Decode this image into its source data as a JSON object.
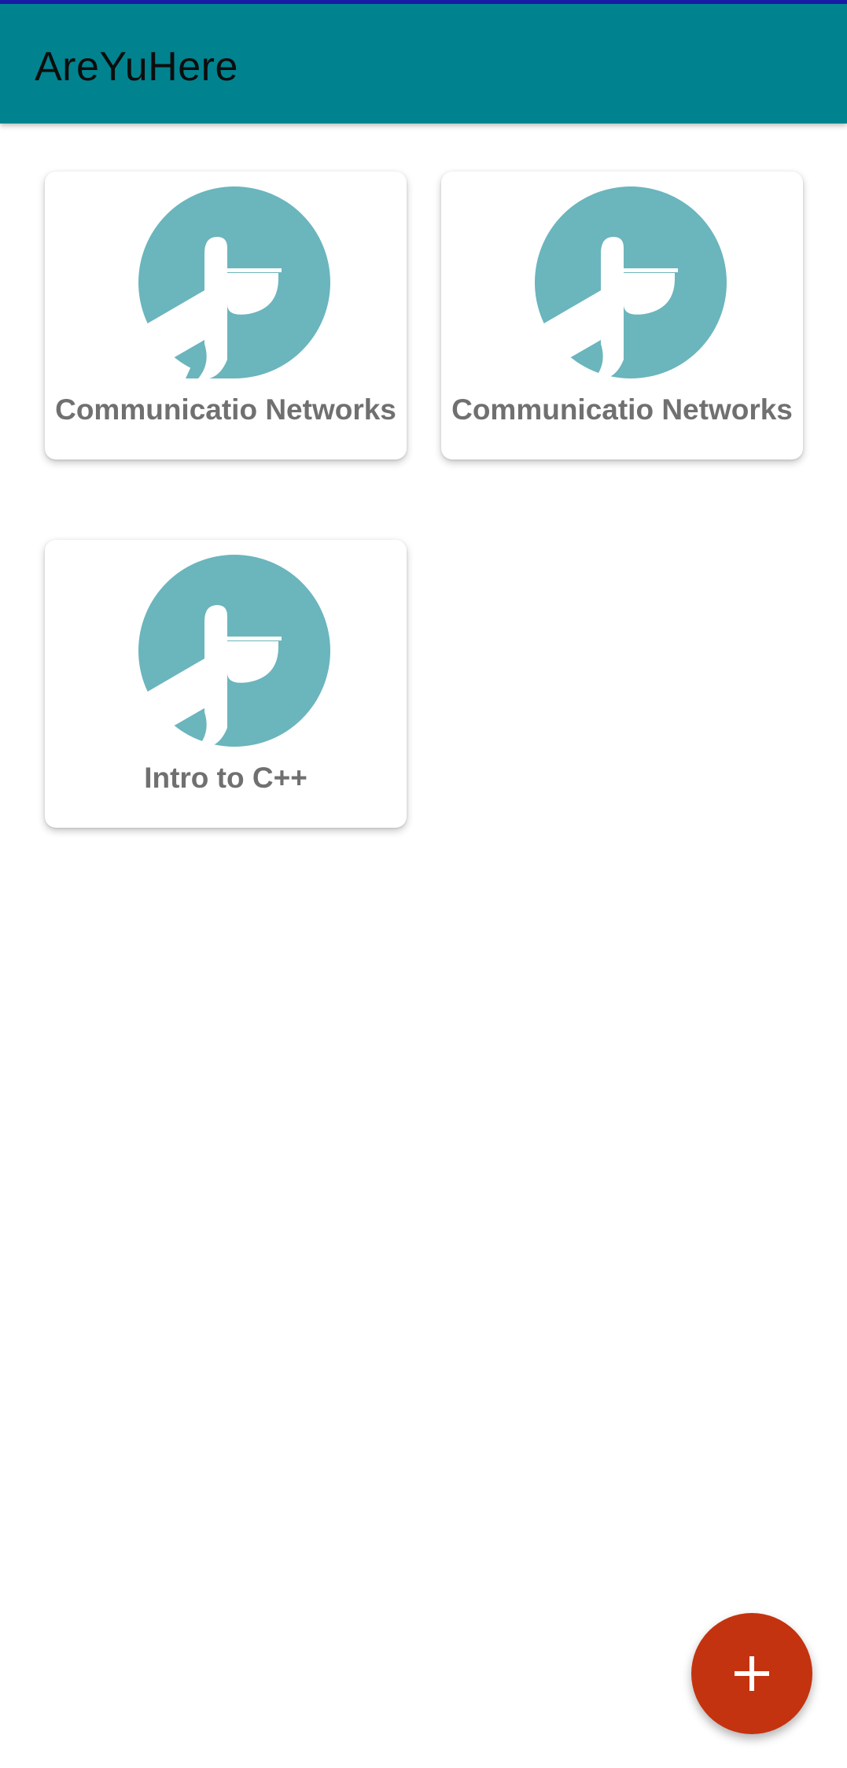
{
  "app_bar": {
    "title": "AreYuHere",
    "background_color": "#00838f"
  },
  "courses": [
    {
      "name": "Communicatio Networks",
      "icon": "pelican-logo-icon"
    },
    {
      "name": "Communicatio Networks",
      "icon": "pelican-logo-icon"
    },
    {
      "name": "Intro to C++",
      "icon": "pelican-logo-icon"
    }
  ],
  "fab": {
    "icon": "plus-icon",
    "color": "#c4330f"
  },
  "colors": {
    "logo_circle": "#6bb5bd",
    "course_text": "#707070"
  }
}
